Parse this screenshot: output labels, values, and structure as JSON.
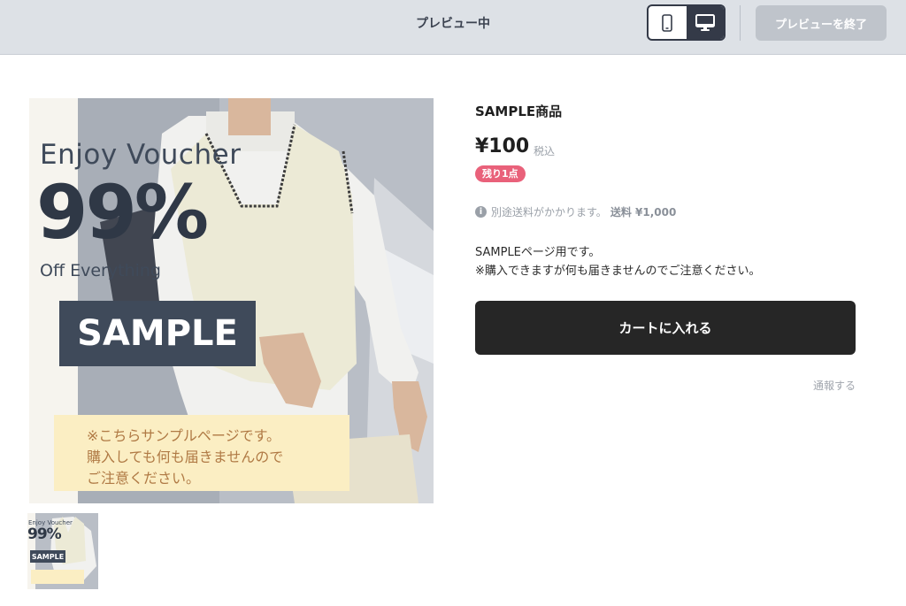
{
  "topbar": {
    "title": "プレビュー中",
    "end_preview_label": "プレビューを終了"
  },
  "product": {
    "name": "SAMPLE商品",
    "price": "¥100",
    "tax_label": "税込",
    "stock_badge": "残り1点",
    "shipping_note": "別途送料がかかります。",
    "shipping_fee": "送料 ¥1,000",
    "description_line1": "SAMPLEページ用です。",
    "description_line2": "※購入できますが何も届きませんのでご注意ください。",
    "cart_button": "カートに入れる",
    "report_link": "通報する"
  },
  "banner": {
    "headline": "Enjoy Voucher",
    "percent": "99%",
    "subline": "Off Everything",
    "sample_label": "SAMPLE",
    "notice_line1": "※こちらサンプルページです。",
    "notice_line2": "購入しても何も届きませんので",
    "notice_line3": "ご注意ください。"
  },
  "colors": {
    "topbar_bg": "#dde1e6",
    "device_active": "#343a48",
    "cart_button_bg": "#262626",
    "stock_badge_bg": "#e9617a",
    "notice_bg": "#fbeec3",
    "notice_text": "#b07a45",
    "sample_box_bg": "#3f4a5a"
  },
  "icons": {
    "mobile": "mobile-device-icon",
    "desktop": "desktop-monitor-icon",
    "info": "info-circle-icon"
  }
}
